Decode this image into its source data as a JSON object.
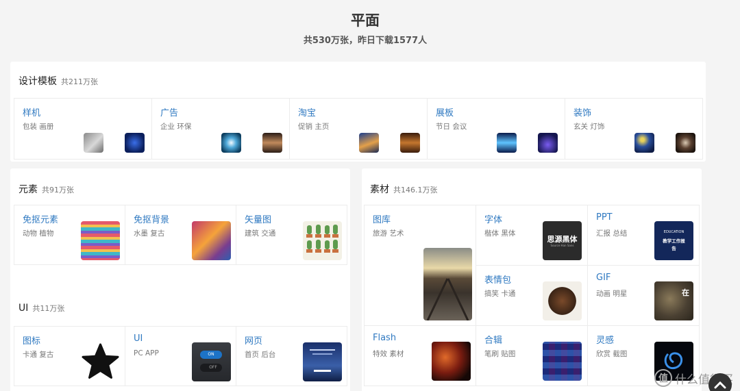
{
  "header": {
    "title": "平面",
    "subtitle": "共530万张，昨日下载1577人"
  },
  "sections": {
    "design": {
      "title": "设计模板",
      "count": "共211万张",
      "cards": [
        {
          "title": "样机",
          "tags": "包装 画册"
        },
        {
          "title": "广告",
          "tags": "企业 环保"
        },
        {
          "title": "淘宝",
          "tags": "促销 主页"
        },
        {
          "title": "展板",
          "tags": "节日 会议"
        },
        {
          "title": "装饰",
          "tags": "玄关 灯饰"
        }
      ]
    },
    "elements": {
      "title": "元素",
      "count": "共91万张",
      "cards": [
        {
          "title": "免抠元素",
          "tags": "动物 植物"
        },
        {
          "title": "免抠背景",
          "tags": "水墨 复古"
        },
        {
          "title": "矢量图",
          "tags": "建筑 交通"
        }
      ]
    },
    "ui": {
      "title": "UI",
      "count": "共11万张",
      "cards": [
        {
          "title": "图标",
          "tags": "卡通 复古"
        },
        {
          "title": "UI",
          "tags": "PC APP",
          "toggle_on": "ON",
          "toggle_off": "OFF"
        },
        {
          "title": "网页",
          "tags": "首页 后台"
        }
      ]
    },
    "materials": {
      "title": "素材",
      "count": "共146.1万张",
      "cards": [
        {
          "title": "图库",
          "tags": "旅游 艺术"
        },
        {
          "title": "字体",
          "tags": "楷体 黑体",
          "thumb_text": "思源黑体",
          "thumb_sub": "Source Han Sans"
        },
        {
          "title": "PPT",
          "tags": "汇报 总结",
          "thumb_top": "EDUCATION",
          "thumb_text": "教学工作报告"
        },
        {
          "title": "表情包",
          "tags": "搞笑 卡通"
        },
        {
          "title": "GIF",
          "tags": "动画 明星",
          "thumb_text": "在"
        },
        {
          "title": "Flash",
          "tags": "特效 素材"
        },
        {
          "title": "合辑",
          "tags": "笔刷 贴图"
        },
        {
          "title": "灵感",
          "tags": "欣赏 截图"
        }
      ]
    }
  },
  "footer": {
    "brand_mark": "值",
    "brand_text": "什么值得买"
  },
  "colors": {
    "link": "#2f79c1",
    "page_bg": "#f4f4f4",
    "panel_bg": "#ffffff"
  }
}
